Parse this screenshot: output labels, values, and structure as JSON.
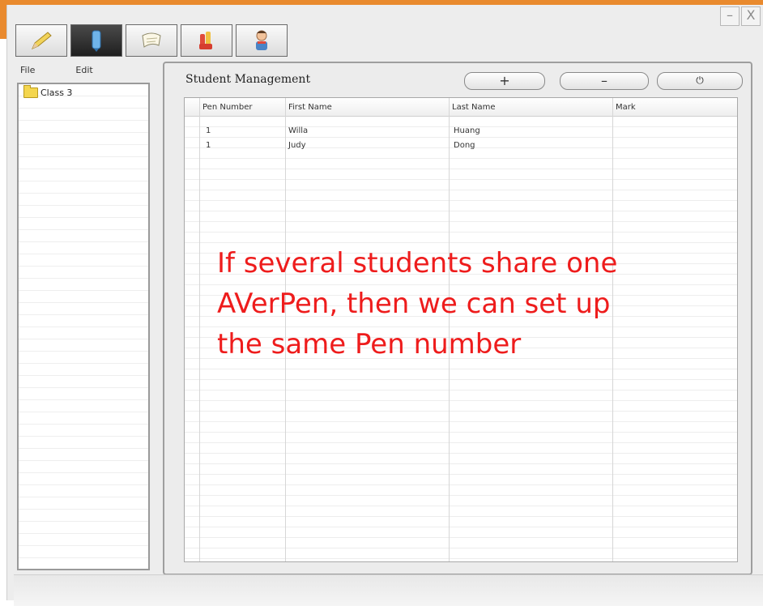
{
  "window": {
    "minimize_label": "–",
    "close_label": "X"
  },
  "toolbar": {
    "tools": [
      {
        "icon": "pencil-icon",
        "active": false
      },
      {
        "icon": "pen-device-icon",
        "active": true
      },
      {
        "icon": "paper-roll-icon",
        "active": false
      },
      {
        "icon": "hand-raise-icon",
        "active": false
      },
      {
        "icon": "student-avatar-icon",
        "active": false
      }
    ]
  },
  "menu": {
    "file": "File",
    "edit": "Edit"
  },
  "tree": {
    "items": [
      {
        "label": "Class 3",
        "icon": "folder-icon"
      }
    ]
  },
  "panel": {
    "title": "Student Management",
    "add_label": "+",
    "remove_label": "–",
    "power_label": "⏻"
  },
  "table": {
    "columns": [
      "Pen Number",
      "First Name",
      "Last Name",
      "Mark"
    ],
    "rows": [
      [
        "1",
        "Willa",
        "Huang",
        ""
      ],
      [
        "1",
        "Judy",
        "Dong",
        ""
      ]
    ]
  },
  "annotation": {
    "lines": [
      "If several students share one",
      "AVerPen, then we can set up",
      "the same Pen number"
    ],
    "color": "#ee1c1c"
  },
  "colors": {
    "accent": "#e98a2e"
  }
}
